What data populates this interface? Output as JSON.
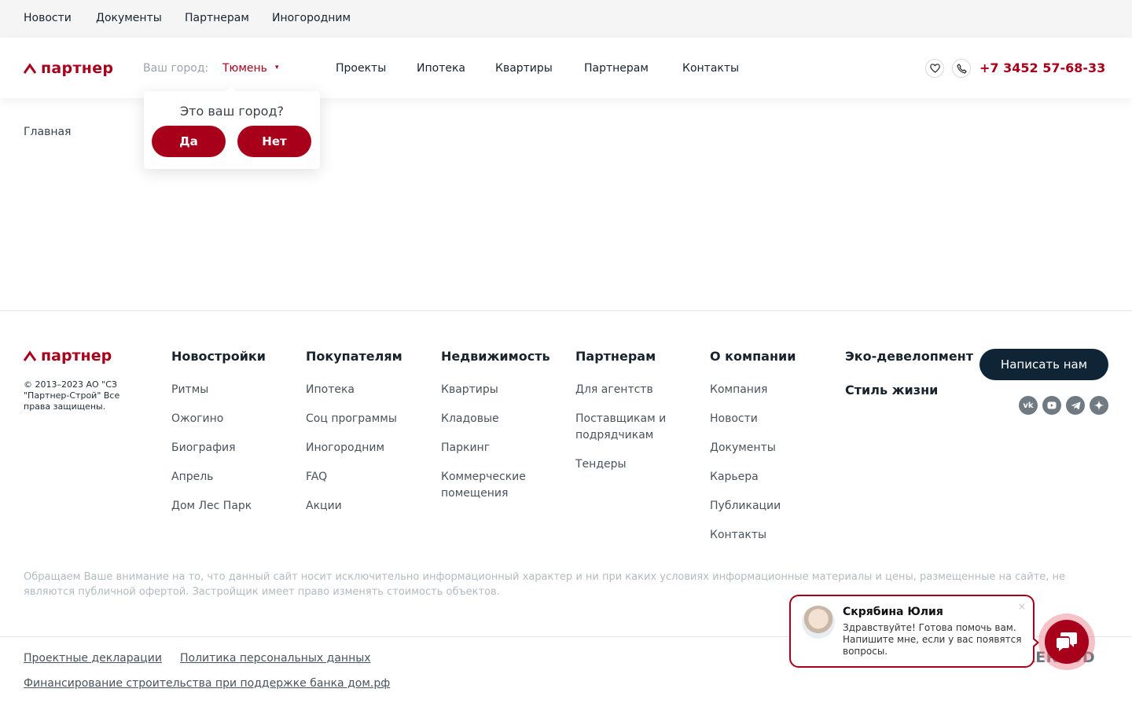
{
  "topbar": {
    "links": [
      "Новости",
      "Документы",
      "Партнерам",
      "Иногородним"
    ]
  },
  "header": {
    "logo_text": "партнер",
    "city_label": "Ваш город:",
    "city_value": "Тюмень",
    "nav": [
      "Проекты",
      "Ипотека",
      "Квартиры",
      "Партнерам",
      "Контакты"
    ],
    "phone": "+7 3452 57-68-33"
  },
  "city_popup": {
    "question": "Это ваш город?",
    "yes": "Да",
    "no": "Нет"
  },
  "breadcrumb": "Главная",
  "footer": {
    "logo_text": "партнер",
    "copyright": "© 2013–2023 АО \"СЗ \"Партнер-Строй\" Все права защищены.",
    "columns": [
      {
        "head": "Новостройки",
        "items": [
          "Ритмы",
          "Ожогино",
          "Биография",
          "Апрель",
          "Дом Лес Парк"
        ]
      },
      {
        "head": "Покупателям",
        "items": [
          "Ипотека",
          "Соц программы",
          "Иногородним",
          "FAQ",
          "Акции"
        ]
      },
      {
        "head": "Недвижимость",
        "items": [
          "Квартиры",
          "Кладовые",
          "Паркинг",
          "Коммерческие помещения"
        ]
      },
      {
        "head": "Партнерам",
        "items": [
          "Для агентств",
          "Поставщикам и подрядчикам",
          "Тендеры"
        ]
      },
      {
        "head": "О компании",
        "items": [
          "Компания",
          "Новости",
          "Документы",
          "Карьера",
          "Публикации",
          "Контакты"
        ]
      }
    ],
    "eco": "Эко-девелопмент",
    "lifestyle": "Стиль жизни",
    "write_button": "Написать нам",
    "social": [
      "vk-icon",
      "youtube-icon",
      "telegram-icon",
      "zen-icon"
    ],
    "disclaimer": "Обращаем Ваше внимание на то, что данный сайт носит исключительно информационный характер и ни при каких условиях информационные материалы и цены, размещенные на сайте, не являются публичной офертой. Застройщик имеет право изменять стоимость объектов.",
    "bottom_links": [
      "Проектные декларации",
      "Политика персональных данных",
      "Финансирование строительства при поддержке банка дом.рф"
    ],
    "developer_logo": "AERKOD"
  },
  "chat": {
    "name": "Скрябина Юлия",
    "message": "Здравствуйте! Готова помочь вам. Напишите мне, если у вас появятся вопросы.",
    "close": "×"
  },
  "colors": {
    "brand": "#a8001a",
    "dark": "#0f2536"
  }
}
